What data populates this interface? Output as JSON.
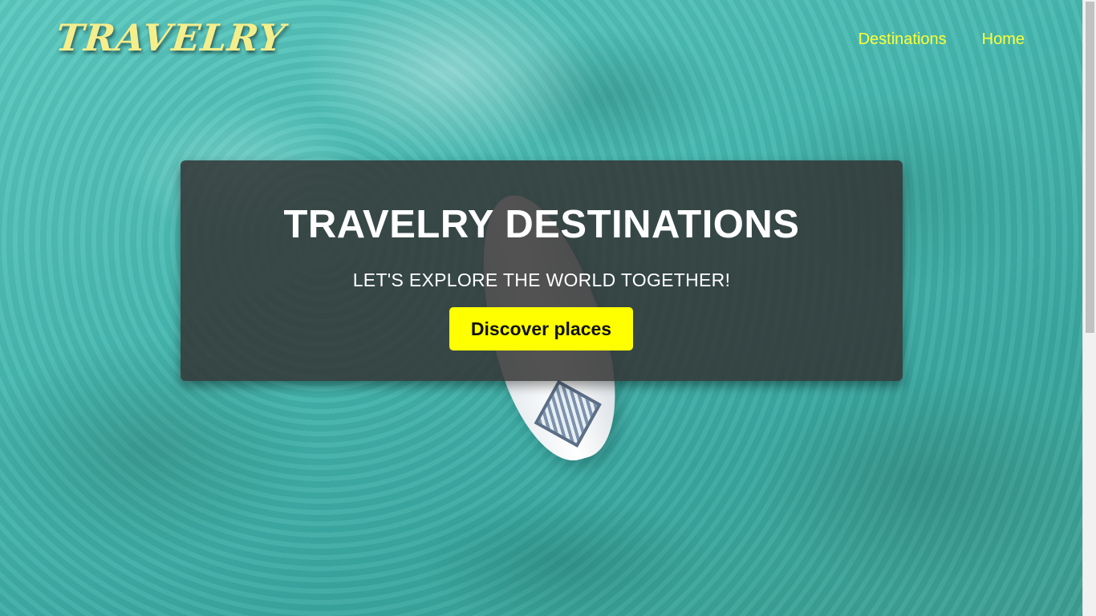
{
  "brand": {
    "logo_text": "TRAVELRY"
  },
  "nav": {
    "items": [
      {
        "label": "Destinations"
      },
      {
        "label": "Home"
      }
    ]
  },
  "hero": {
    "title": "TRAVELRY DESTINATIONS",
    "subtitle": "LET'S EXPLORE THE WORLD TOGETHER!",
    "cta_label": "Discover places"
  },
  "colors": {
    "accent": "#ffff00",
    "nav_link": "#ffff33",
    "logo": "#f4ee8c",
    "card_bg": "rgba(52,52,52,0.85)",
    "water": "#46b8b0"
  }
}
